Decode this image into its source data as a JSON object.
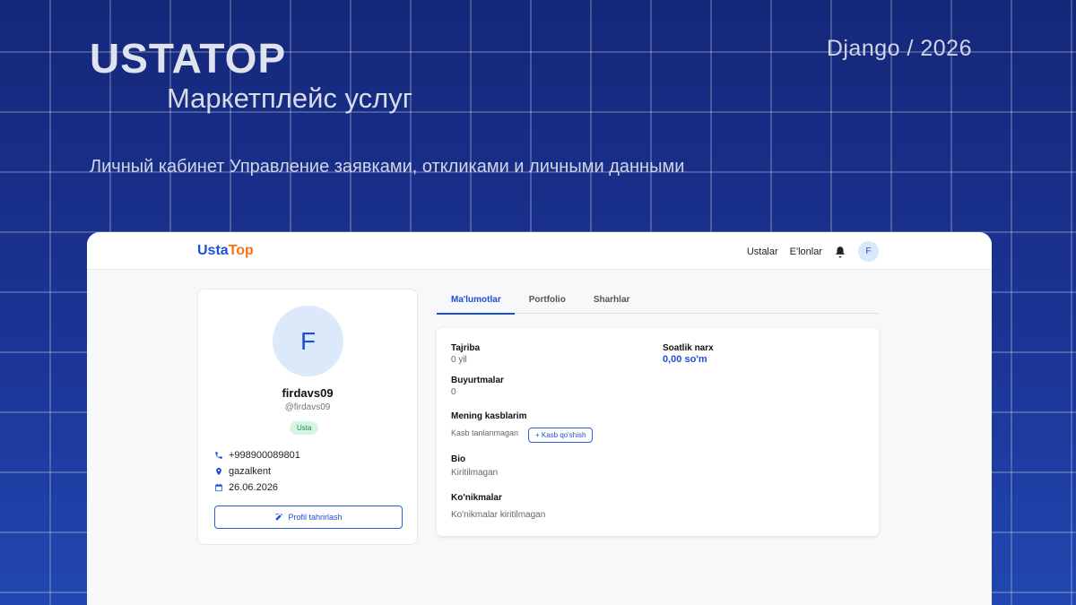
{
  "slide": {
    "title": "USTATOP",
    "subtitle": "Маркетплейс услуг",
    "tech": "Django / 2026",
    "tagline": "Личный кабинет Управление заявками, откликами и личными данными"
  },
  "app": {
    "logo": {
      "part1": "Usta",
      "part2": "Top"
    },
    "nav": {
      "masters": "Ustalar",
      "ads": "E'lonlar",
      "avatar_initial": "F"
    },
    "profile": {
      "initial": "F",
      "name": "firdavs09",
      "handle": "@firdavs09",
      "badge": "Usta",
      "phone": "+998900089801",
      "location": "gazalkent",
      "date": "26.06.2026",
      "edit_label": "Profil tahrirlash"
    },
    "tabs": [
      "Ma'lumotlar",
      "Portfolio",
      "Sharhlar"
    ],
    "details": {
      "experience_label": "Tajriba",
      "experience_value": "0 yil",
      "price_label": "Soatlik narx",
      "price_value": "0,00 so'm",
      "orders_label": "Buyurtmalar",
      "orders_value": "0",
      "professions_label": "Mening kasblarim",
      "professions_value": "Kasb tanlanmagan",
      "add_profession": "+ Kasb qo'shish",
      "bio_label": "Bio",
      "bio_value": "Kiritilmagan",
      "skills_label": "Ko'nikmalar",
      "skills_value": "Ko'nikmalar kiritilmagan"
    }
  },
  "colors": {
    "accent": "#1d4ed8",
    "logo_orange": "#f97316",
    "badge_bg": "#d7f5e3"
  }
}
